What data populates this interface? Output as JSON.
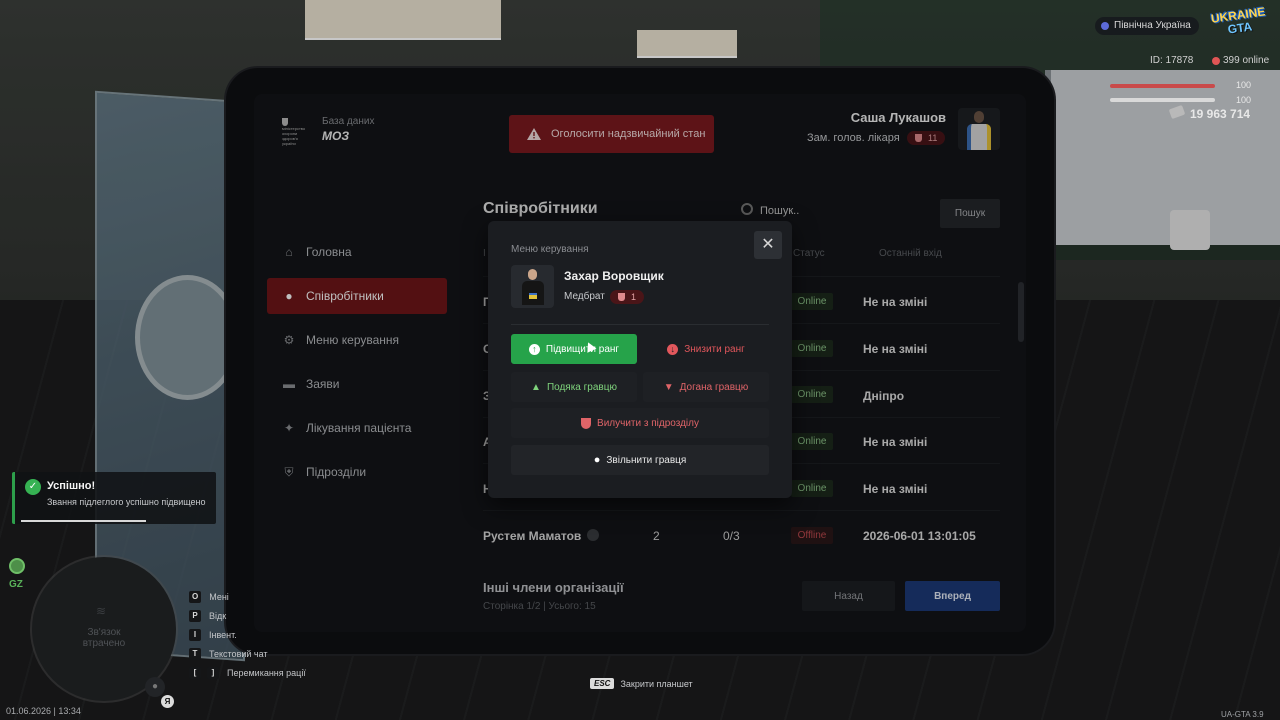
{
  "hud": {
    "region": "Північна Україна",
    "logo_line1": "UKRAINE",
    "logo_line2": "GTA",
    "player_id": "ID: 17878",
    "online": "399 online",
    "health": "100",
    "armor": "100",
    "money": "19 963 714",
    "datetime": "01.06.2026 | 13:34",
    "version": "UA-GTA 3.9",
    "gz_label": "GZ",
    "minimap_text": "Зв'язок втрачено",
    "mic_key": "Я",
    "keys": [
      {
        "key": "O",
        "label": "Мені"
      },
      {
        "key": "P",
        "label": "Відк"
      },
      {
        "key": "I",
        "label": "Інвент."
      },
      {
        "key": "T",
        "label": "Текстовий чат"
      },
      {
        "key_pair": [
          "[",
          "]"
        ],
        "label": "Перемикання рації"
      }
    ],
    "esc_key": "ESC",
    "esc_label": "Закрити планшет"
  },
  "toast": {
    "title": "Успішно!",
    "text": "Звання підлеглого успішно підвищено",
    "progress": 0.65
  },
  "tablet": {
    "brand_small": "міністерство охорони здоров'я україни",
    "brand_sub": "База даних",
    "brand_title": "МОЗ",
    "emergency_button": "Оголосити надзвичайний стан",
    "user": {
      "name": "Саша Лукашов",
      "role": "Зам. голов. лікаря",
      "rank": "11"
    },
    "nav": [
      {
        "label": "Головна",
        "icon": "home-icon",
        "active": false
      },
      {
        "label": "Співробітники",
        "icon": "users-icon",
        "active": true
      },
      {
        "label": "Меню керування",
        "icon": "gear-icon",
        "active": false
      },
      {
        "label": "Заяви",
        "icon": "folder-icon",
        "active": false
      },
      {
        "label": "Лікування пацієнта",
        "icon": "sparkle-icon",
        "active": false
      },
      {
        "label": "Підрозділи",
        "icon": "shield-icon",
        "active": false
      }
    ],
    "main": {
      "title": "Співробітники",
      "search_placeholder": "Пошук..",
      "search_button": "Пошук",
      "headers": {
        "id": "І",
        "status": "Статус",
        "last_seen": "Останній вхід"
      },
      "rows": [
        {
          "name": "П",
          "status": "Online",
          "last_seen": "Не на зміні"
        },
        {
          "name": "С",
          "status": "Online",
          "last_seen": "Не на зміні"
        },
        {
          "name": "З",
          "status": "Online",
          "last_seen": "Дніпро"
        },
        {
          "name": "А",
          "status": "Online",
          "last_seen": "Не на зміні"
        },
        {
          "name": "Н",
          "status": "Online",
          "last_seen": "Не на зміні"
        },
        {
          "name": "Рустем Маматов",
          "rank": "2",
          "warnings": "0/3",
          "status": "Offline",
          "last_seen": "2026-06-01 13:01:05"
        }
      ],
      "others_title": "Інші члени організації",
      "page_info": "Сторінка 1/2 | Усього: 15",
      "back_button": "Назад",
      "next_button": "Вперед"
    },
    "modal": {
      "label": "Меню керування",
      "name": "Захар Воровщик",
      "role": "Медбрат",
      "rank": "1",
      "actions": {
        "promote": "Підвищити ранг",
        "demote": "Знизити ранг",
        "thanks": "Подяка гравцю",
        "reprimand": "Догана гравцю",
        "exclude": "Вилучити з підрозділу",
        "dismiss": "Звільнити гравця"
      }
    }
  },
  "colors": {
    "accent_red": "#6f1619",
    "promote_green": "#26a34a",
    "online_green": "#8fc58a",
    "offline_red": "#c04a4f",
    "next_blue": "#1d3a78"
  }
}
